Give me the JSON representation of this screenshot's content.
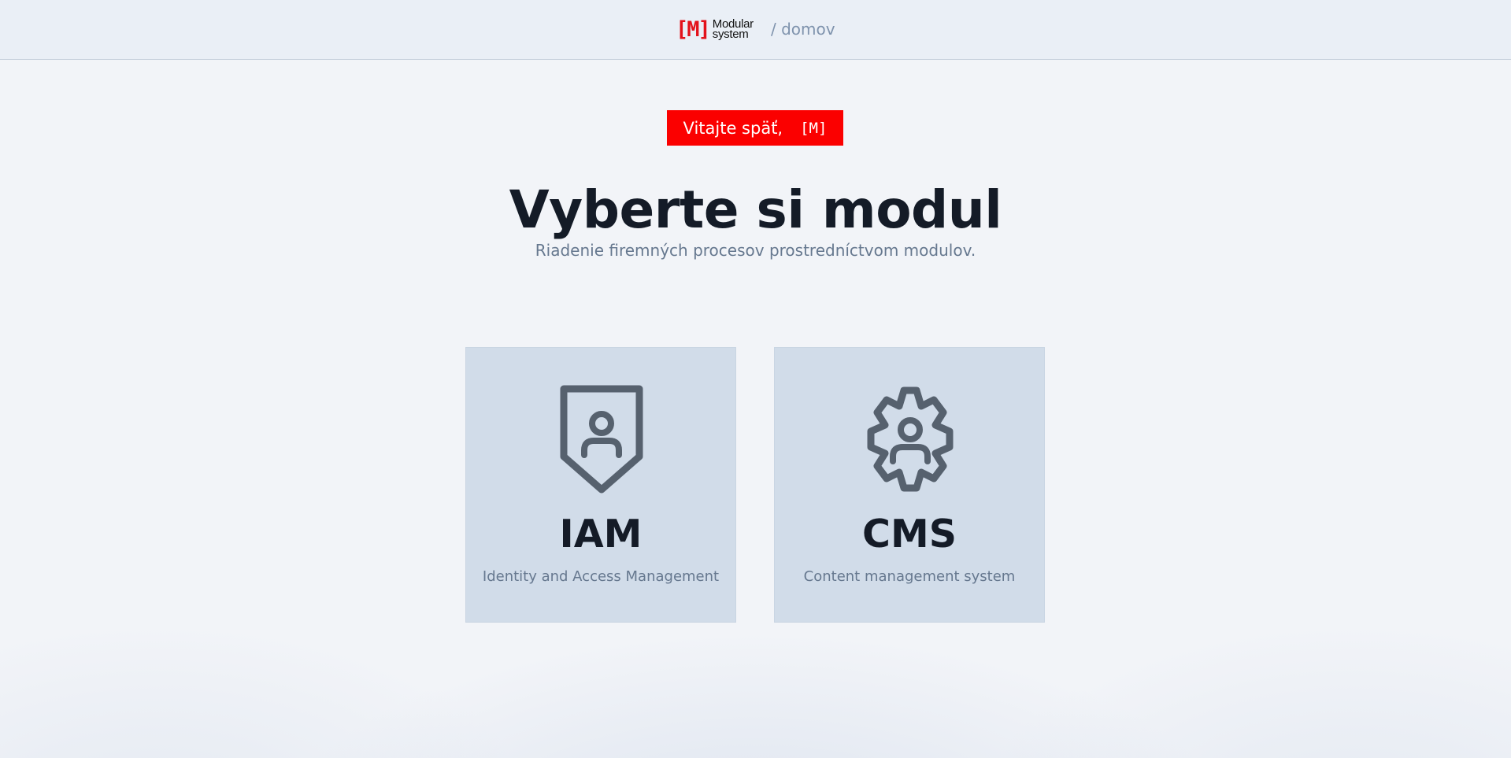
{
  "header": {
    "logo": {
      "mark": "[M]",
      "line1": "Modular",
      "line2": "system"
    },
    "breadcrumb": {
      "separator": "/",
      "current": "domov"
    }
  },
  "welcome": {
    "text": "Vitajte späť,",
    "user": "[M]"
  },
  "page": {
    "title": "Vyberte si modul",
    "subtitle": "Riadenie firemných procesov prostredníctvom modulov."
  },
  "modules": [
    {
      "icon": "shield-user-icon",
      "name": "IAM",
      "description": "Identity and Access Management"
    },
    {
      "icon": "gear-user-icon",
      "name": "CMS",
      "description": "Content management system"
    }
  ],
  "colors": {
    "brand_red": "#fb0000",
    "logo_red": "#e3121b",
    "card_bg": "#d1dce9",
    "icon": "#56616e",
    "title": "#141b27",
    "muted": "#66788f"
  }
}
